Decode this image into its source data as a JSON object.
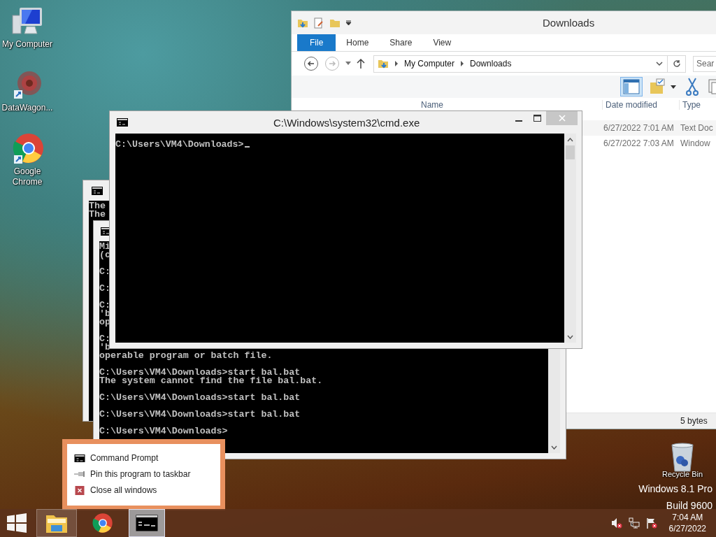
{
  "desktop_icons": [
    {
      "label": "My Computer",
      "kind": "computer"
    },
    {
      "label": "DataWagon...",
      "kind": "app"
    },
    {
      "label": "Google Chrome",
      "kind": "chrome"
    }
  ],
  "recycle_bin": {
    "label": "Recycle Bin"
  },
  "os_watermark": [
    "Windows 8.1 Pro",
    "Build 9600"
  ],
  "explorer": {
    "title": "Downloads",
    "tabs": [
      {
        "label": "File",
        "selected": true
      },
      {
        "label": "Home",
        "selected": false
      },
      {
        "label": "Share",
        "selected": false
      },
      {
        "label": "View",
        "selected": false
      }
    ],
    "breadcrumb": [
      "My Computer",
      "Downloads"
    ],
    "search": {
      "placeholder": "Sear"
    },
    "toolbar": [
      {
        "kind": "preview",
        "selected": true
      },
      {
        "kind": "folder",
        "selected": false
      },
      {
        "kind": "cut",
        "selected": false
      },
      {
        "kind": "copy",
        "selected": false
      }
    ],
    "columns": [
      "Name",
      "Date modified",
      "Type"
    ],
    "rows": [
      {
        "date": "6/27/2022 7:01 AM",
        "type": "Text Doc"
      },
      {
        "date": "6/27/2022 7:03 AM",
        "type": "Window"
      }
    ],
    "status": "5 bytes"
  },
  "cmd_back_left": {
    "lines": [
      "The",
      "The"
    ]
  },
  "cmd_back": {
    "lines": [
      {
        "text": "Mi",
        "blank_before": false
      },
      {
        "text": "(c",
        "blank_before": false
      },
      {
        "text": "C:",
        "blank_before": true
      },
      {
        "text": "C:",
        "blank_before": true
      },
      {
        "text": "C:",
        "blank_before": true
      },
      {
        "text": "'b",
        "blank_before": false
      },
      {
        "text": "op",
        "blank_before": false
      },
      {
        "text": "C:",
        "blank_before": true
      },
      {
        "text": "'b",
        "blank_before": false
      },
      {
        "text": "operable program or batch file.",
        "blank_before": false
      },
      {
        "text": "C:\\Users\\VM4\\Downloads>start bal.bat",
        "blank_before": true
      },
      {
        "text": "The system cannot find the file bal.bat.",
        "blank_before": false
      },
      {
        "text": "C:\\Users\\VM4\\Downloads>start bal.bat",
        "blank_before": true
      },
      {
        "text": "C:\\Users\\VM4\\Downloads>start bal.bat",
        "blank_before": true
      },
      {
        "text": "C:\\Users\\VM4\\Downloads>",
        "blank_before": true
      }
    ]
  },
  "cmd_front": {
    "title": "C:\\Windows\\system32\\cmd.exe",
    "lines": [
      "C:\\Users\\VM4\\Downloads>"
    ]
  },
  "jump_list": [
    {
      "label": "Command Prompt",
      "kind": "app"
    },
    {
      "label": "Pin this program to taskbar",
      "kind": "pin"
    },
    {
      "label": "Close all windows",
      "kind": "close"
    }
  ],
  "taskbar": {
    "buttons": [
      {
        "kind": "start",
        "running": false,
        "selected": false
      },
      {
        "kind": "explorer",
        "running": true,
        "selected": false
      },
      {
        "kind": "chrome",
        "running": false,
        "selected": false
      },
      {
        "kind": "cmd",
        "running": true,
        "selected": true
      }
    ],
    "tray": [
      {
        "kind": "volume"
      },
      {
        "kind": "network"
      },
      {
        "kind": "flag"
      }
    ],
    "time": "7:04 AM",
    "date": "6/27/2022"
  }
}
